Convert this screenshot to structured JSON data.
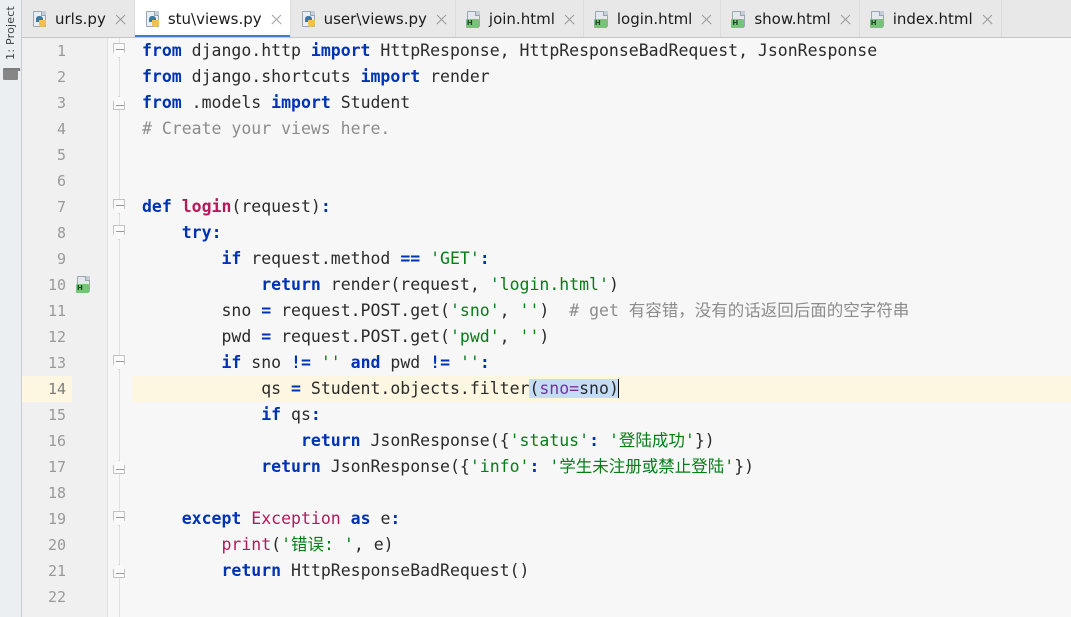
{
  "tool_window": {
    "project_label": "1: Project",
    "folder_icon": "folder-icon"
  },
  "tabs": [
    {
      "label": "urls.py",
      "icon": "python-file-icon",
      "active": false,
      "badge": ""
    },
    {
      "label": "stu\\views.py",
      "icon": "python-file-icon",
      "active": true,
      "badge": ""
    },
    {
      "label": "user\\views.py",
      "icon": "python-file-icon",
      "active": false,
      "badge": ""
    },
    {
      "label": "join.html",
      "icon": "html-file-icon",
      "active": false,
      "badge": "H"
    },
    {
      "label": "login.html",
      "icon": "html-file-icon",
      "active": false,
      "badge": "H"
    },
    {
      "label": "show.html",
      "icon": "html-file-icon",
      "active": false,
      "badge": "H"
    },
    {
      "label": "index.html",
      "icon": "html-file-icon",
      "active": false,
      "badge": "H"
    }
  ],
  "editor": {
    "current_line": 14,
    "line_count": 22,
    "line_numbers": [
      "1",
      "2",
      "3",
      "4",
      "5",
      "6",
      "7",
      "8",
      "9",
      "10",
      "11",
      "12",
      "13",
      "14",
      "15",
      "16",
      "17",
      "18",
      "19",
      "20",
      "21",
      "22"
    ],
    "gutter_icons": [
      {
        "line": 10,
        "icon": "html-file-icon",
        "badge": "H"
      }
    ],
    "fold_markers": [
      {
        "line": 1,
        "type": "open"
      },
      {
        "line": 3,
        "type": "close"
      },
      {
        "line": 7,
        "type": "open"
      },
      {
        "line": 8,
        "type": "open"
      },
      {
        "line": 13,
        "type": "open"
      },
      {
        "line": 17,
        "type": "close"
      },
      {
        "line": 19,
        "type": "open"
      },
      {
        "line": 21,
        "type": "close"
      }
    ],
    "selection_text": "(sno=sno)",
    "code_plain": [
      "from django.http import HttpResponse, HttpResponseBadRequest, JsonResponse",
      "from django.shortcuts import render",
      "from .models import Student",
      "# Create your views here.",
      "",
      "",
      "def login(request):",
      "    try:",
      "        if request.method == 'GET':",
      "            return render(request, 'login.html')",
      "        sno = request.POST.get('sno', '')  # get 有容错，没有的话返回后面的空字符串",
      "        pwd = request.POST.get('pwd', '')",
      "        if sno != '' and pwd != '':",
      "            qs = Student.objects.filter(sno=sno)",
      "            if qs:",
      "                return JsonResponse({'status': '登陆成功'})",
      "            return JsonResponse({'info': '学生未注册或禁止登陆'})",
      "",
      "    except Exception as e:",
      "        print('错误: ', e)",
      "        return HttpResponseBadRequest()",
      ""
    ],
    "code_tokens": [
      [
        {
          "t": "from",
          "c": "kw"
        },
        {
          "t": " django.http ",
          "c": "pln"
        },
        {
          "t": "import",
          "c": "kw"
        },
        {
          "t": " HttpResponse",
          "c": "pln"
        },
        {
          "t": ",",
          "c": "punc"
        },
        {
          "t": " HttpResponseBadRequest",
          "c": "pln"
        },
        {
          "t": ",",
          "c": "punc"
        },
        {
          "t": " JsonResponse",
          "c": "pln"
        }
      ],
      [
        {
          "t": "from",
          "c": "kw"
        },
        {
          "t": " django.shortcuts ",
          "c": "pln"
        },
        {
          "t": "import",
          "c": "kw"
        },
        {
          "t": " render",
          "c": "pln"
        }
      ],
      [
        {
          "t": "from",
          "c": "kw"
        },
        {
          "t": " .models ",
          "c": "pln"
        },
        {
          "t": "import",
          "c": "kw"
        },
        {
          "t": " Student",
          "c": "pln"
        }
      ],
      [
        {
          "t": "# Create your views here.",
          "c": "cmt"
        }
      ],
      [],
      [],
      [
        {
          "t": "def",
          "c": "kw"
        },
        {
          "t": " ",
          "c": "pln"
        },
        {
          "t": "login",
          "c": "fn"
        },
        {
          "t": "(request)",
          "c": "punc"
        },
        {
          "t": ":",
          "c": "op"
        }
      ],
      [
        {
          "t": "    ",
          "c": "pln"
        },
        {
          "t": "try",
          "c": "kw"
        },
        {
          "t": ":",
          "c": "op"
        }
      ],
      [
        {
          "t": "        ",
          "c": "pln"
        },
        {
          "t": "if",
          "c": "kw"
        },
        {
          "t": " request.method ",
          "c": "pln"
        },
        {
          "t": "==",
          "c": "op"
        },
        {
          "t": " ",
          "c": "pln"
        },
        {
          "t": "'GET'",
          "c": "str"
        },
        {
          "t": ":",
          "c": "op"
        }
      ],
      [
        {
          "t": "            ",
          "c": "pln"
        },
        {
          "t": "return",
          "c": "kw"
        },
        {
          "t": " render(request, ",
          "c": "pln"
        },
        {
          "t": "'login.html'",
          "c": "str"
        },
        {
          "t": ")",
          "c": "pln"
        }
      ],
      [
        {
          "t": "        sno ",
          "c": "pln"
        },
        {
          "t": "=",
          "c": "op"
        },
        {
          "t": " request.POST.get(",
          "c": "pln"
        },
        {
          "t": "'sno'",
          "c": "str"
        },
        {
          "t": ", ",
          "c": "pln"
        },
        {
          "t": "''",
          "c": "str"
        },
        {
          "t": ")  ",
          "c": "pln"
        },
        {
          "t": "# get 有容错，没有的话返回后面的空字符串",
          "c": "cmt"
        }
      ],
      [
        {
          "t": "        pwd ",
          "c": "pln"
        },
        {
          "t": "=",
          "c": "op"
        },
        {
          "t": " request.POST.get(",
          "c": "pln"
        },
        {
          "t": "'pwd'",
          "c": "str"
        },
        {
          "t": ", ",
          "c": "pln"
        },
        {
          "t": "''",
          "c": "str"
        },
        {
          "t": ")",
          "c": "pln"
        }
      ],
      [
        {
          "t": "        ",
          "c": "pln"
        },
        {
          "t": "if",
          "c": "kw"
        },
        {
          "t": " sno ",
          "c": "pln"
        },
        {
          "t": "!=",
          "c": "op"
        },
        {
          "t": " ",
          "c": "pln"
        },
        {
          "t": "''",
          "c": "str"
        },
        {
          "t": " ",
          "c": "pln"
        },
        {
          "t": "and",
          "c": "kw"
        },
        {
          "t": " pwd ",
          "c": "pln"
        },
        {
          "t": "!=",
          "c": "op"
        },
        {
          "t": " ",
          "c": "pln"
        },
        {
          "t": "''",
          "c": "str"
        },
        {
          "t": ":",
          "c": "op"
        }
      ],
      [
        {
          "t": "            qs ",
          "c": "pln"
        },
        {
          "t": "=",
          "c": "op"
        },
        {
          "t": " Student.objects.filter",
          "c": "pln"
        },
        {
          "t": "(",
          "c": "sel-punc"
        },
        {
          "t": "sno=",
          "c": "sel-kwarg"
        },
        {
          "t": "sno",
          "c": "sel-pln"
        },
        {
          "t": ")",
          "c": "sel-punc"
        },
        {
          "t": "|caret|",
          "c": "caret"
        }
      ],
      [
        {
          "t": "            ",
          "c": "pln"
        },
        {
          "t": "if",
          "c": "kw"
        },
        {
          "t": " qs",
          "c": "pln"
        },
        {
          "t": ":",
          "c": "op"
        }
      ],
      [
        {
          "t": "                ",
          "c": "pln"
        },
        {
          "t": "return",
          "c": "kw"
        },
        {
          "t": " JsonResponse({",
          "c": "pln"
        },
        {
          "t": "'status'",
          "c": "str"
        },
        {
          "t": ":",
          "c": "op"
        },
        {
          "t": " ",
          "c": "pln"
        },
        {
          "t": "'登陆成功'",
          "c": "str"
        },
        {
          "t": "})",
          "c": "pln"
        }
      ],
      [
        {
          "t": "            ",
          "c": "pln"
        },
        {
          "t": "return",
          "c": "kw"
        },
        {
          "t": " JsonResponse({",
          "c": "pln"
        },
        {
          "t": "'info'",
          "c": "str"
        },
        {
          "t": ":",
          "c": "op"
        },
        {
          "t": " ",
          "c": "pln"
        },
        {
          "t": "'学生未注册或禁止登陆'",
          "c": "str"
        },
        {
          "t": "})",
          "c": "pln"
        }
      ],
      [],
      [
        {
          "t": "    ",
          "c": "pln"
        },
        {
          "t": "except",
          "c": "kw"
        },
        {
          "t": " ",
          "c": "pln"
        },
        {
          "t": "Exception",
          "c": "cls"
        },
        {
          "t": " ",
          "c": "pln"
        },
        {
          "t": "as",
          "c": "kw"
        },
        {
          "t": " e",
          "c": "pln"
        },
        {
          "t": ":",
          "c": "op"
        }
      ],
      [
        {
          "t": "        ",
          "c": "pln"
        },
        {
          "t": "print",
          "c": "builtin"
        },
        {
          "t": "(",
          "c": "pln"
        },
        {
          "t": "'错误: '",
          "c": "str"
        },
        {
          "t": ", e)",
          "c": "pln"
        }
      ],
      [
        {
          "t": "        ",
          "c": "pln"
        },
        {
          "t": "return",
          "c": "kw"
        },
        {
          "t": " HttpResponseBadRequest()",
          "c": "pln"
        }
      ],
      []
    ]
  },
  "colors": {
    "accent": "#3d7ecc",
    "keyword": "#0033b3",
    "string": "#067d17",
    "comment": "#8c8c8c",
    "function": "#b5195b",
    "kwarg": "#7a2fa0",
    "current_line_bg": "#fdf6e0",
    "selection_bg": "#c6dcf5",
    "editor_bg": "#f7f7f7",
    "gutter_bg": "#f0f0f0",
    "tabbar_bg": "#e8e8e8"
  }
}
